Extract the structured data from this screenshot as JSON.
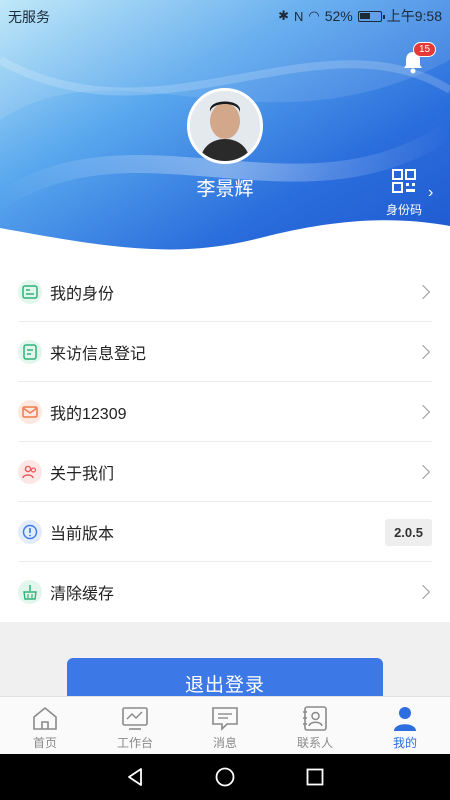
{
  "status_bar": {
    "carrier": "无服务",
    "battery_percent": "52%",
    "time": "上午9:58"
  },
  "header": {
    "notification_count": "15",
    "user_name": "李景辉",
    "id_code_label": "身份码"
  },
  "menu": {
    "items": [
      {
        "label": "我的身份",
        "icon": "id-card-icon"
      },
      {
        "label": "来访信息登记",
        "icon": "form-icon"
      },
      {
        "label": "我的12309",
        "icon": "mail-icon"
      },
      {
        "label": "关于我们",
        "icon": "users-icon"
      },
      {
        "label": "当前版本",
        "icon": "info-icon",
        "value": "2.0.5"
      },
      {
        "label": "清除缓存",
        "icon": "broom-icon"
      }
    ]
  },
  "logout_label": "退出登录",
  "tabs": [
    {
      "label": "首页",
      "icon": "home-icon"
    },
    {
      "label": "工作台",
      "icon": "monitor-icon"
    },
    {
      "label": "消息",
      "icon": "message-icon"
    },
    {
      "label": "联系人",
      "icon": "contact-icon"
    },
    {
      "label": "我的",
      "icon": "person-icon",
      "active": true
    }
  ],
  "colors": {
    "primary": "#2e6de0",
    "logout_button": "#3d79e6",
    "header_dark": "#1f5fd6",
    "header_light": "#a8dcf5"
  }
}
